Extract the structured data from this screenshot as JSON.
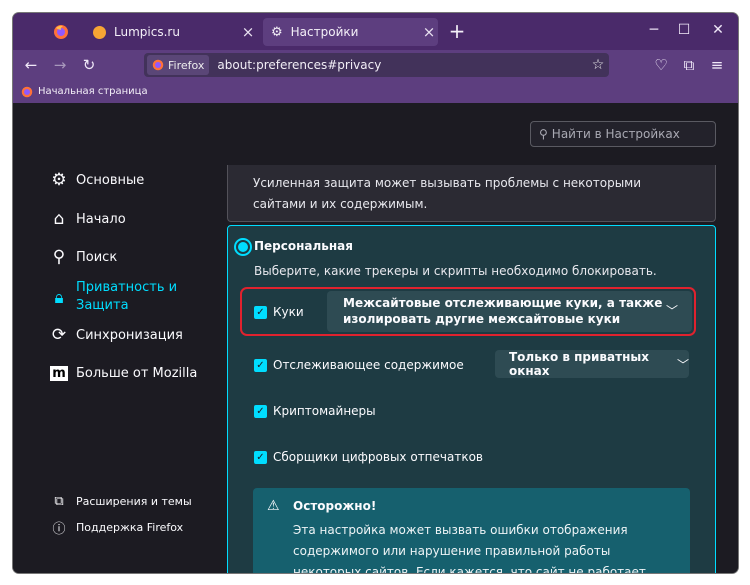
{
  "tabs": [
    {
      "label": "Lumpics.ru",
      "icon": "lumpics-favicon"
    },
    {
      "label": "Настройки",
      "icon": "gear-icon",
      "active": true
    }
  ],
  "navbar": {
    "identity_label": "Firefox",
    "url": "about:preferences#privacy"
  },
  "bookmarks": {
    "item_label": "Начальная страница"
  },
  "search": {
    "placeholder": "Найти в Настройках"
  },
  "sidebar": {
    "items": [
      {
        "label": "Основные",
        "icon": "gear-icon"
      },
      {
        "label": "Начало",
        "icon": "home-icon"
      },
      {
        "label": "Поиск",
        "icon": "search-icon"
      },
      {
        "label": "Приватность и Защита",
        "icon": "lock-icon",
        "selected": true
      },
      {
        "label": "Синхронизация",
        "icon": "sync-icon"
      },
      {
        "label": "Больше от Mozilla",
        "icon": "mozilla-icon"
      }
    ],
    "footer": [
      {
        "label": "Расширения и темы",
        "icon": "puzzle-icon"
      },
      {
        "label": "Поддержка Firefox",
        "icon": "help-icon"
      }
    ]
  },
  "strict_note": {
    "text": "Усиленная защита может вызывать проблемы с некоторыми сайтами и их содержимым."
  },
  "personal": {
    "title": "Персональная",
    "description": "Выберите, какие трекеры и скрипты необходимо блокировать.",
    "cookies": {
      "label": "Куки",
      "checked": true,
      "select_value": "Межсайтовые отслеживающие куки, а также изолировать другие межсайтовые куки"
    },
    "tracking": {
      "label": "Отслеживающее содержимое",
      "checked": true,
      "select_value": "Только в приватных окнах"
    },
    "cryptominers": {
      "label": "Криптомайнеры",
      "checked": true
    },
    "fingerprinters": {
      "label": "Сборщики цифровых отпечатков",
      "checked": true
    },
    "caution": {
      "title": "Осторожно!",
      "text": "Эта настройка может вызвать ошибки отображения содержимого или нарушение правильной работы некоторых сайтов. Если кажется, что сайт не работает, вам, возможно, понадобится"
    }
  },
  "colors": {
    "accent": "#00ddff",
    "tab_strip": "#4a2a6a",
    "toolbar": "#5d3e7f",
    "highlight": "#e0222e"
  }
}
